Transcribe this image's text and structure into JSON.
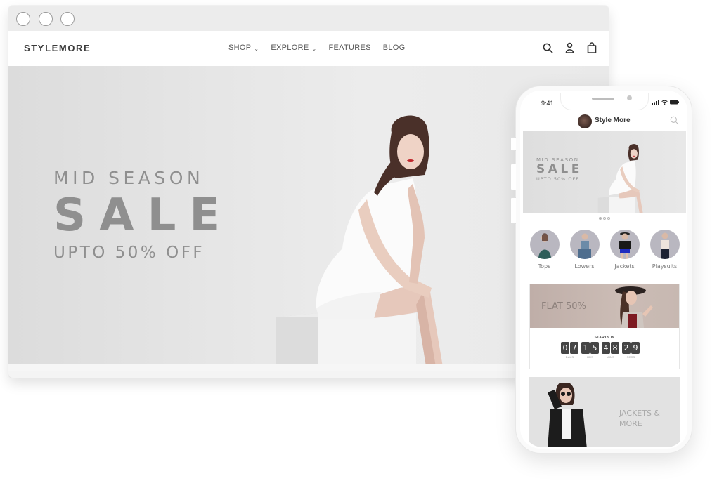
{
  "desktop": {
    "window_controls": [
      "close",
      "minimize",
      "maximize"
    ],
    "brand": "STYLEMORE",
    "nav": [
      {
        "label": "SHOP",
        "has_dropdown": true
      },
      {
        "label": "EXPLORE",
        "has_dropdown": true
      },
      {
        "label": "FEATURES",
        "has_dropdown": false
      },
      {
        "label": "BLOG",
        "has_dropdown": false
      }
    ],
    "icons": [
      "search-icon",
      "user-icon",
      "shopping-bag-icon"
    ],
    "hero": {
      "line1": "MID SEASON",
      "line2": "SALE",
      "line3": "UPTO 50% OFF"
    }
  },
  "mobile": {
    "status": {
      "time": "9:41"
    },
    "app_title": "Style More",
    "hero": {
      "line1": "MID SEASON",
      "line2": "SALE",
      "line3": "UPTO 50% OFF"
    },
    "carousel": {
      "count": 3,
      "active_index": 0
    },
    "categories": [
      {
        "label": "Tops",
        "color": "#2f5e5a"
      },
      {
        "label": "Lowers",
        "color": "#4f6e8e"
      },
      {
        "label": "Jackets",
        "color": "#1f2cc0"
      },
      {
        "label": "Playsuits",
        "color": "#e9dfd9"
      }
    ],
    "flat_sale": {
      "title": "FLAT 50%",
      "starts_in_label": "STARTS IN",
      "countdown": [
        {
          "digits": [
            "0",
            "7"
          ],
          "unit": "DAYS"
        },
        {
          "digits": [
            "1",
            "5"
          ],
          "unit": "HRS"
        },
        {
          "digits": [
            "4",
            "8"
          ],
          "unit": "MINS"
        },
        {
          "digits": [
            "2",
            "9"
          ],
          "unit": "SECS"
        }
      ]
    },
    "jackets_banner": {
      "line1": "JACKETS &",
      "line2": "MORE"
    }
  }
}
